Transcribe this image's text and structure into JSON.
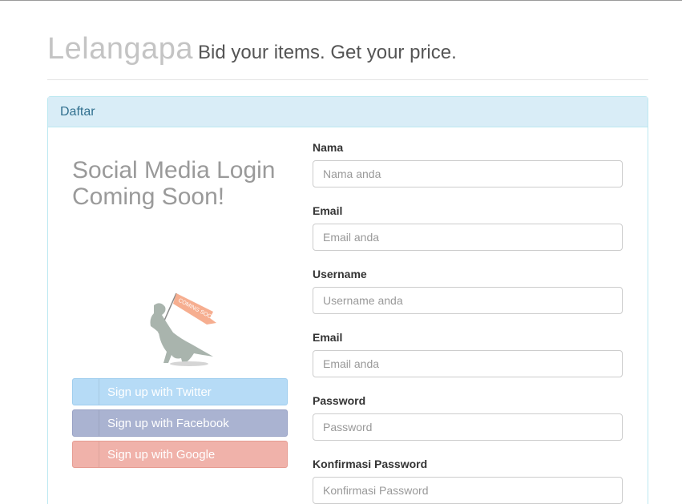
{
  "header": {
    "brand": "Lelangapa",
    "tagline": "Bid your items. Get your price."
  },
  "panel": {
    "heading": "Daftar"
  },
  "social": {
    "title_line1": "Social Media Login",
    "title_line2": "Coming Soon!",
    "banner_text": "COMING SOON!",
    "buttons": [
      {
        "label": "Sign up with Twitter",
        "icon": "twitter-icon",
        "color": "#b6dbf6"
      },
      {
        "label": "Sign up with Facebook",
        "icon": "facebook-icon",
        "color": "#aab3d1"
      },
      {
        "label": "Sign up with Google",
        "icon": "google-icon",
        "color": "#f0b2aa"
      }
    ]
  },
  "form": {
    "fields": [
      {
        "label": "Nama",
        "placeholder": "Nama anda",
        "value": ""
      },
      {
        "label": "Email",
        "placeholder": "Email anda",
        "value": ""
      },
      {
        "label": "Username",
        "placeholder": "Username anda",
        "value": ""
      },
      {
        "label": "Email",
        "placeholder": "Email anda",
        "value": ""
      },
      {
        "label": "Password",
        "placeholder": "Password",
        "value": ""
      },
      {
        "label": "Konfirmasi Password",
        "placeholder": "Konfirmasi Password",
        "value": ""
      }
    ]
  }
}
